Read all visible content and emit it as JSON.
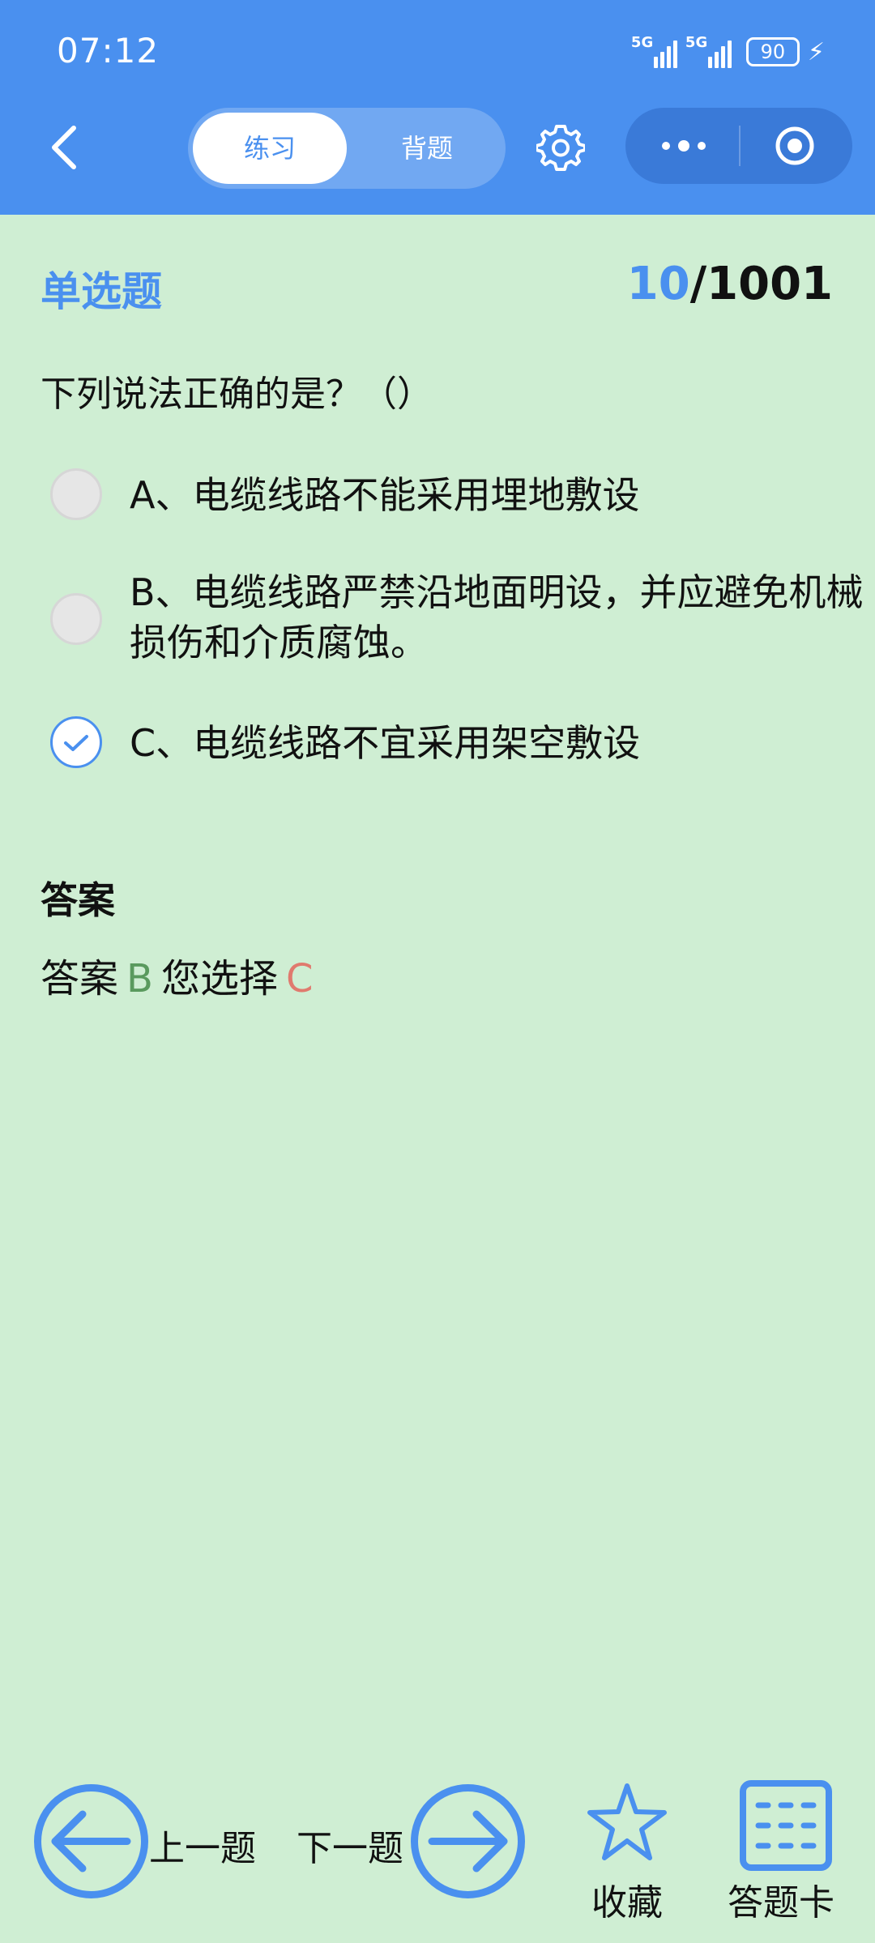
{
  "status": {
    "time": "07:12",
    "network1": "5G",
    "network2": "5G",
    "battery": "90"
  },
  "header": {
    "tab_practice": "练习",
    "tab_memorize": "背题",
    "icons": [
      "back-icon",
      "gear-icon",
      "more-icon",
      "target-icon"
    ]
  },
  "question": {
    "type": "单选题",
    "current": "10",
    "total": "/1001",
    "text": "下列说法正确的是？（）",
    "options": [
      {
        "text": "A、电缆线路不能采用埋地敷设",
        "checked": false
      },
      {
        "text": "B、电缆线路严禁沿地面明设，并应避免机械损伤和介质腐蚀。",
        "checked": false
      },
      {
        "text": "C、电缆线路不宜采用架空敷设",
        "checked": true
      }
    ]
  },
  "answer": {
    "title": "答案",
    "label": "答案",
    "correct": "B",
    "chosen_label": "您选择",
    "chosen": "C"
  },
  "bottom": {
    "prev": "上一题",
    "next": "下一题",
    "favorite": "收藏",
    "card": "答题卡"
  },
  "colors": {
    "accent": "#4a90ef",
    "background": "#cfeed3",
    "correct": "#5a9a5e",
    "wrong": "#e07a6e"
  }
}
